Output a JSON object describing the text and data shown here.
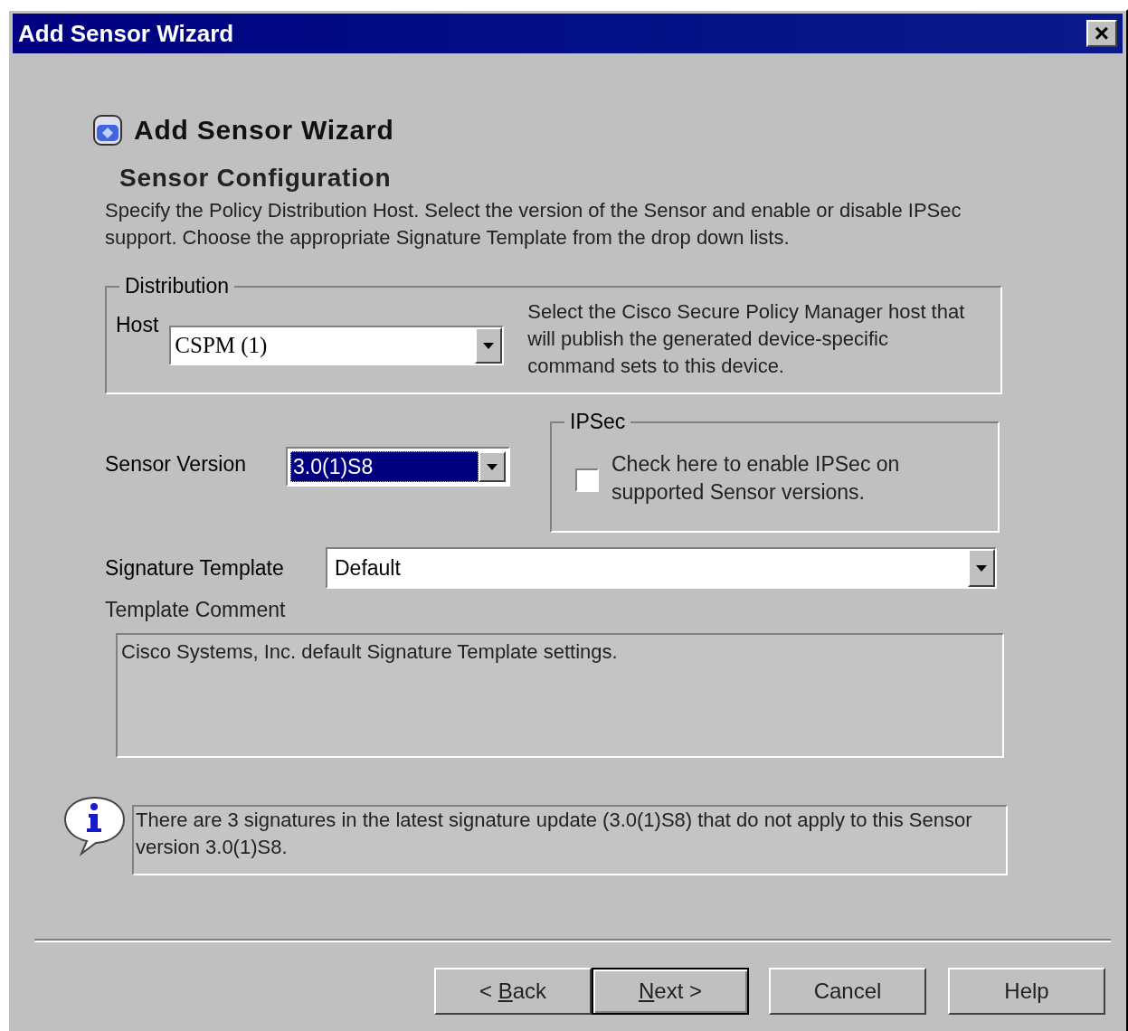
{
  "window": {
    "title": "Add Sensor Wizard",
    "close": "×"
  },
  "header": {
    "title": "Add Sensor Wizard",
    "subtitle": "Sensor Configuration",
    "description": "Specify the Policy Distribution Host.  Select the version of the Sensor and enable or disable IPSec support.  Choose the appropriate Signature Template from the drop down lists."
  },
  "distribution": {
    "legend": "Distribution",
    "host_label": "Host",
    "host_value": "CSPM (1)",
    "hint": "Select the Cisco Secure Policy Manager host that will publish the generated device-specific command sets to this device."
  },
  "sensor_version": {
    "label": "Sensor Version",
    "value": "3.0(1)S8",
    "selected": true
  },
  "ipsec": {
    "legend": "IPSec",
    "label": "Check here to enable IPSec on supported Sensor versions.",
    "checked": false
  },
  "signature_template": {
    "label": "Signature Template",
    "value": "Default"
  },
  "template_comment": {
    "label": "Template Comment",
    "value": "Cisco Systems, Inc. default Signature Template settings."
  },
  "info": {
    "message": "There are 3 signatures in the latest signature update (3.0(1)S8) that do not apply to this Sensor version 3.0(1)S8."
  },
  "buttons": [
    {
      "pre": "< ",
      "key": "B",
      "post": "ack",
      "default": false
    },
    {
      "key": "N",
      "post": "ext >",
      "default": true
    },
    {
      "post": "Cancel",
      "default": false
    },
    {
      "post": "Help",
      "default": false
    }
  ]
}
